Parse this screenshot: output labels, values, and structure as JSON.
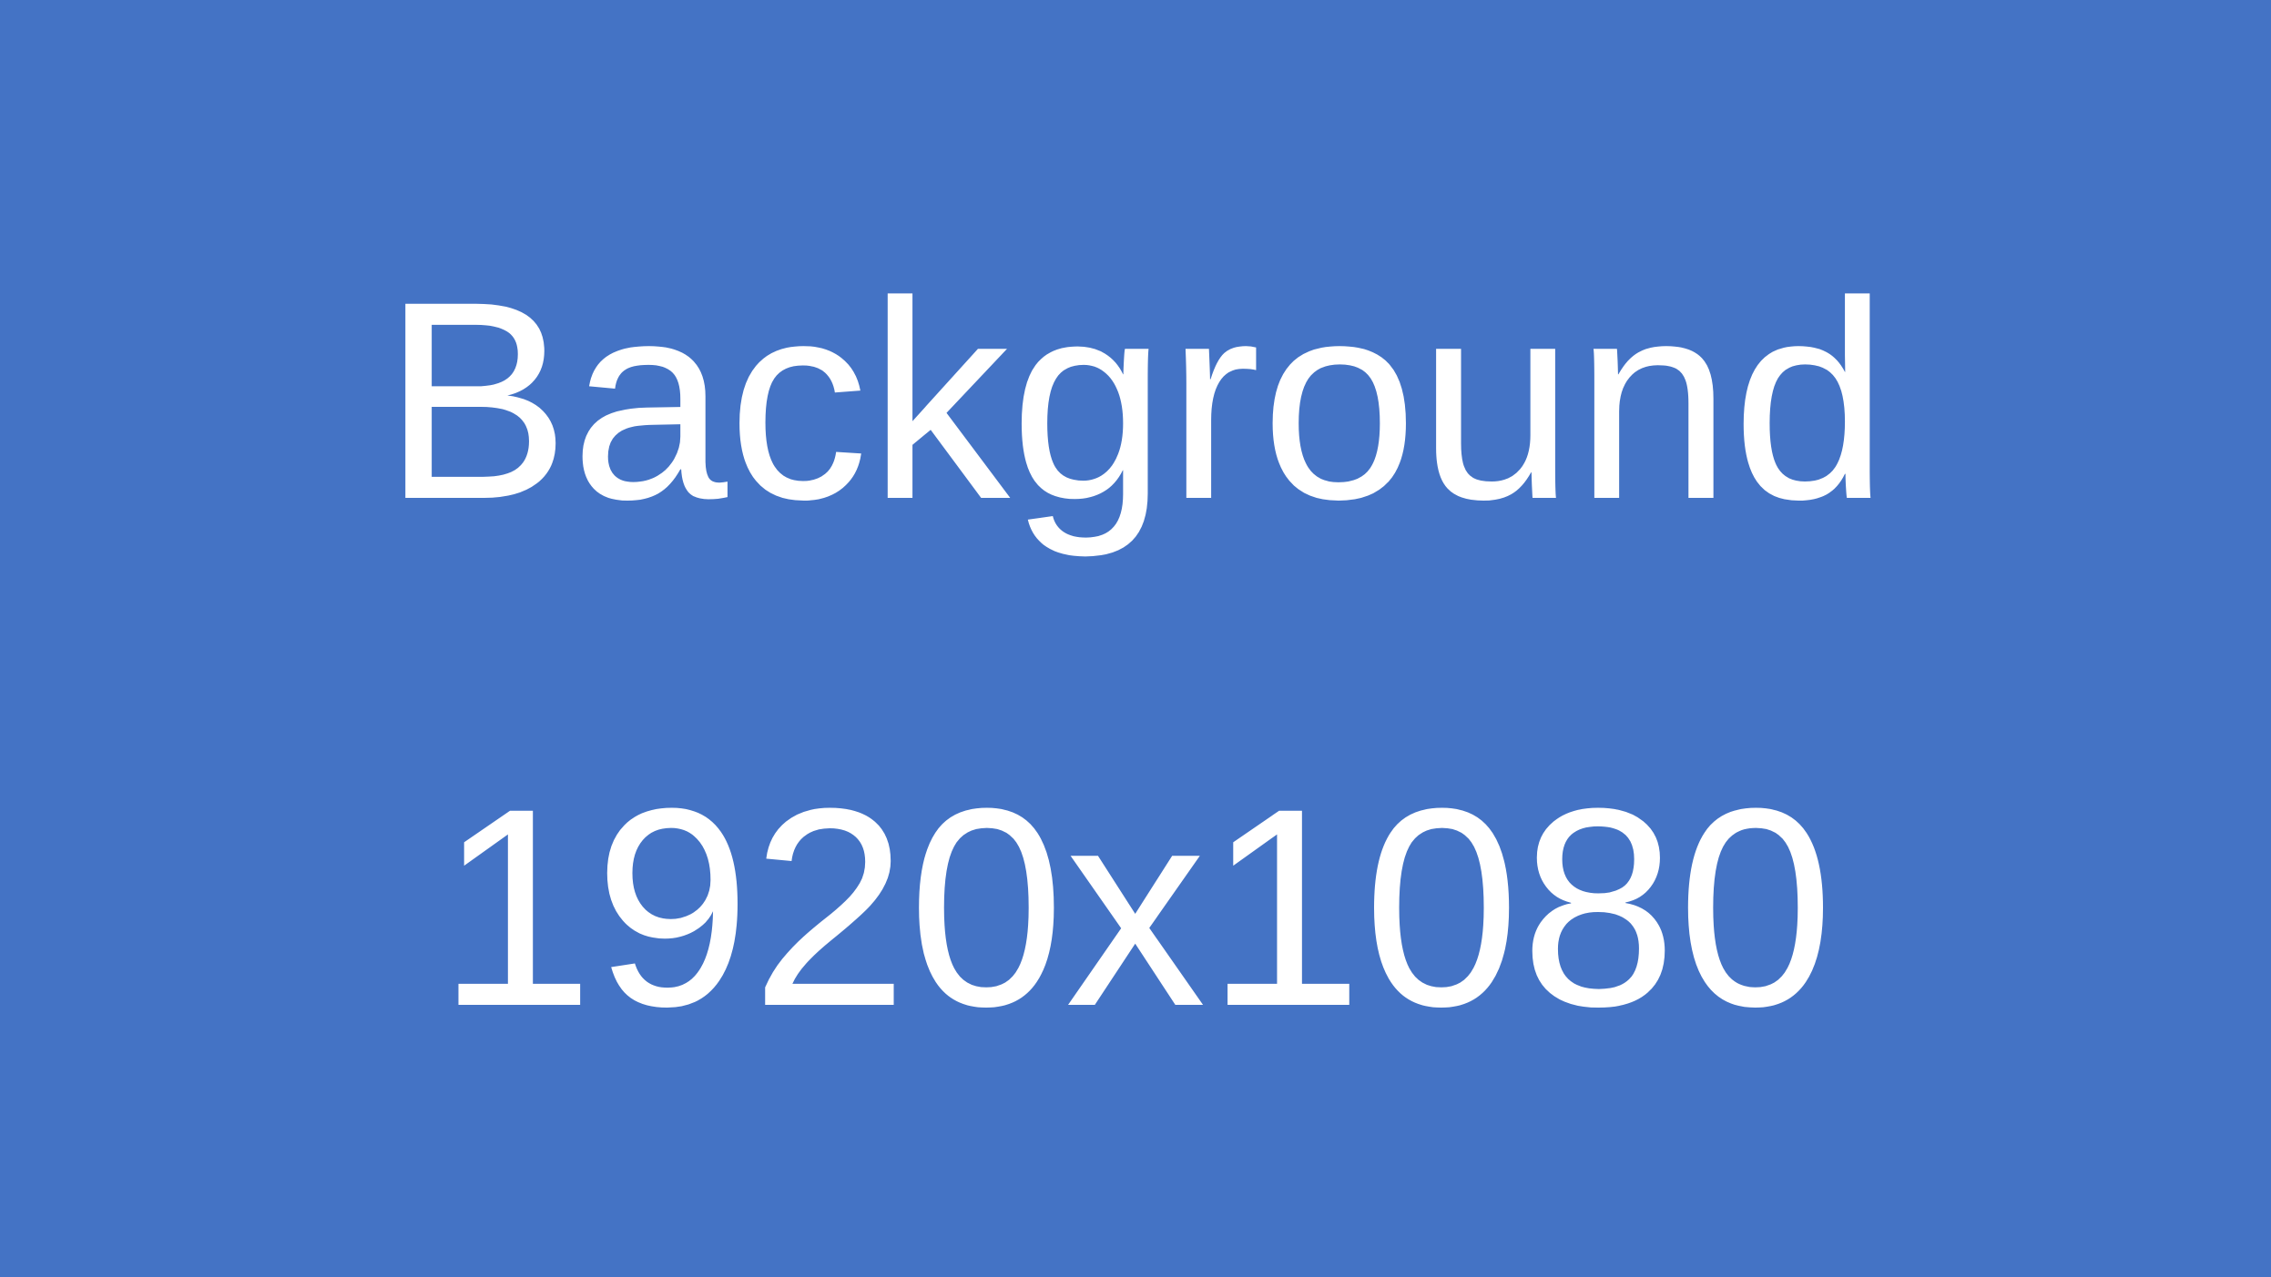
{
  "background_color": "#4473c5",
  "text_color": "#ffffff",
  "lines": [
    "Background",
    "1920x1080"
  ]
}
